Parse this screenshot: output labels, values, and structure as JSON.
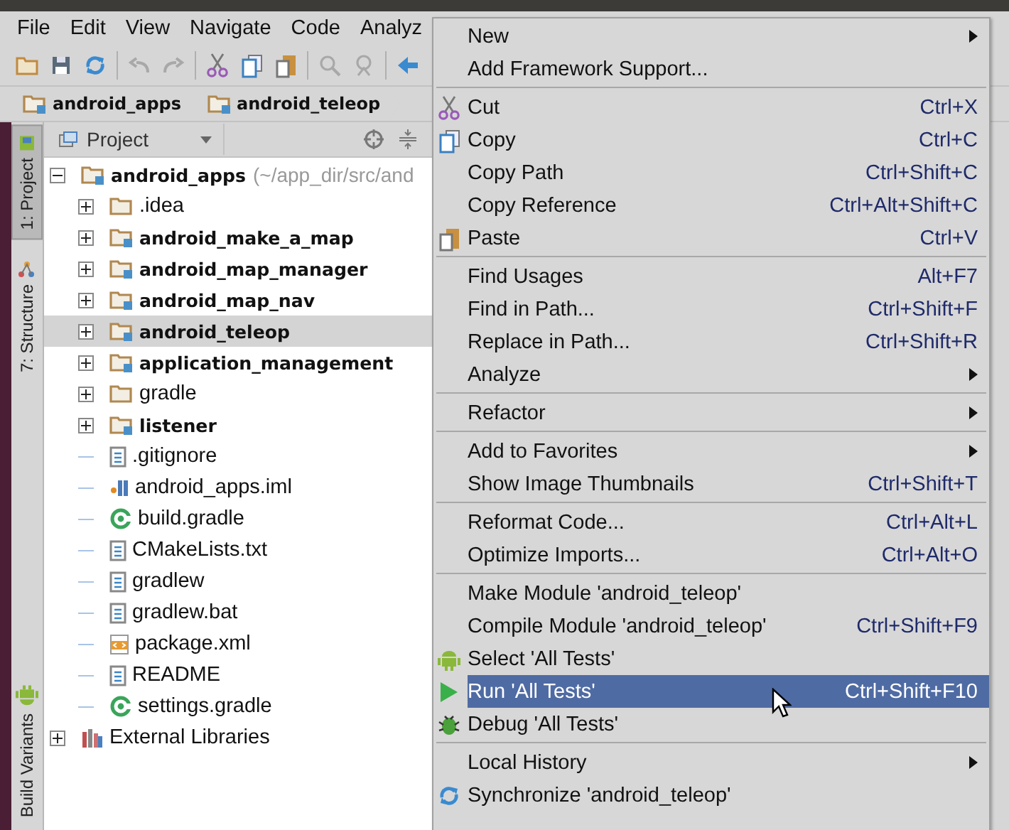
{
  "menubar": [
    {
      "label": "File"
    },
    {
      "label": "Edit"
    },
    {
      "label": "View"
    },
    {
      "label": "Navigate"
    },
    {
      "label": "Code"
    },
    {
      "label": "Analyz"
    }
  ],
  "toolbar": [
    {
      "kind": "open",
      "disabled": false
    },
    {
      "kind": "save",
      "disabled": false
    },
    {
      "kind": "sync",
      "disabled": false
    },
    {
      "kind": "sep"
    },
    {
      "kind": "undo",
      "disabled": true
    },
    {
      "kind": "redo",
      "disabled": true
    },
    {
      "kind": "sep"
    },
    {
      "kind": "cut",
      "disabled": false
    },
    {
      "kind": "copy",
      "disabled": false
    },
    {
      "kind": "paste",
      "disabled": false
    },
    {
      "kind": "sep"
    },
    {
      "kind": "find",
      "disabled": true
    },
    {
      "kind": "replace",
      "disabled": true
    },
    {
      "kind": "sep"
    },
    {
      "kind": "back",
      "disabled": false
    }
  ],
  "breadcrumbs": [
    {
      "label": "android_apps"
    },
    {
      "label": "android_teleop"
    }
  ],
  "side_tabs": {
    "top": [
      {
        "label": "1: Project",
        "selected": true,
        "kind": "project"
      },
      {
        "label": "7: Structure",
        "selected": false,
        "kind": "structure"
      }
    ],
    "bottom": [
      {
        "label": "Build Variants",
        "selected": false,
        "kind": "android"
      }
    ]
  },
  "project_panel": {
    "view": "Project"
  },
  "tree": [
    {
      "label": "android_apps",
      "path": "(~/app_dir/src/and",
      "kind": "module",
      "bold": true,
      "selected": false,
      "expanded": true,
      "children": [
        {
          "label": ".idea",
          "kind": "folder",
          "bold": false,
          "selected": false,
          "expanded": false
        },
        {
          "label": "android_make_a_map",
          "kind": "module",
          "bold": true,
          "selected": false,
          "expanded": false
        },
        {
          "label": "android_map_manager",
          "kind": "module",
          "bold": true,
          "selected": false,
          "expanded": false
        },
        {
          "label": "android_map_nav",
          "kind": "module",
          "bold": true,
          "selected": false,
          "expanded": false
        },
        {
          "label": "android_teleop",
          "kind": "module",
          "bold": true,
          "selected": true,
          "expanded": false
        },
        {
          "label": "application_management",
          "kind": "module",
          "bold": true,
          "selected": false,
          "expanded": false
        },
        {
          "label": "gradle",
          "kind": "folder",
          "bold": false,
          "selected": false,
          "expanded": false
        },
        {
          "label": "listener",
          "kind": "module",
          "bold": true,
          "selected": false,
          "expanded": false
        },
        {
          "label": ".gitignore",
          "kind": "text",
          "bold": false,
          "selected": false
        },
        {
          "label": "android_apps.iml",
          "kind": "iml",
          "bold": false,
          "selected": false
        },
        {
          "label": "build.gradle",
          "kind": "gradle",
          "bold": false,
          "selected": false
        },
        {
          "label": "CMakeLists.txt",
          "kind": "text",
          "bold": false,
          "selected": false
        },
        {
          "label": "gradlew",
          "kind": "text",
          "bold": false,
          "selected": false
        },
        {
          "label": "gradlew.bat",
          "kind": "text",
          "bold": false,
          "selected": false
        },
        {
          "label": "package.xml",
          "kind": "xml",
          "bold": false,
          "selected": false
        },
        {
          "label": "README",
          "kind": "text",
          "bold": false,
          "selected": false
        },
        {
          "label": "settings.gradle",
          "kind": "gradle",
          "bold": false,
          "selected": false
        }
      ]
    },
    {
      "label": "External Libraries",
      "kind": "libraries",
      "bold": false,
      "selected": false,
      "expanded": false
    }
  ],
  "context_menu": [
    [
      {
        "label": "New",
        "submenu": true,
        "selected": false
      },
      {
        "label": "Add Framework Support...",
        "selected": false
      }
    ],
    [
      {
        "label": "Cut",
        "shortcut": "Ctrl+X",
        "kind": "cut",
        "selected": false
      },
      {
        "label": "Copy",
        "shortcut": "Ctrl+C",
        "kind": "copy",
        "selected": false
      },
      {
        "label": "Copy Path",
        "shortcut": "Ctrl+Shift+C",
        "selected": false
      },
      {
        "label": "Copy Reference",
        "shortcut": "Ctrl+Alt+Shift+C",
        "selected": false
      },
      {
        "label": "Paste",
        "shortcut": "Ctrl+V",
        "kind": "paste",
        "selected": false
      }
    ],
    [
      {
        "label": "Find Usages",
        "shortcut": "Alt+F7",
        "selected": false
      },
      {
        "label": "Find in Path...",
        "shortcut": "Ctrl+Shift+F",
        "selected": false
      },
      {
        "label": "Replace in Path...",
        "shortcut": "Ctrl+Shift+R",
        "selected": false
      },
      {
        "label": "Analyze",
        "submenu": true,
        "selected": false
      }
    ],
    [
      {
        "label": "Refactor",
        "submenu": true,
        "selected": false
      }
    ],
    [
      {
        "label": "Add to Favorites",
        "submenu": true,
        "selected": false
      },
      {
        "label": "Show Image Thumbnails",
        "shortcut": "Ctrl+Shift+T",
        "selected": false
      }
    ],
    [
      {
        "label": "Reformat Code...",
        "shortcut": "Ctrl+Alt+L",
        "selected": false
      },
      {
        "label": "Optimize Imports...",
        "shortcut": "Ctrl+Alt+O",
        "selected": false
      }
    ],
    [
      {
        "label": "Make Module 'android_teleop'",
        "selected": false
      },
      {
        "label": "Compile Module 'android_teleop'",
        "shortcut": "Ctrl+Shift+F9",
        "selected": false
      },
      {
        "label": "Select 'All Tests'",
        "kind": "android",
        "selected": false
      },
      {
        "label": "Run 'All Tests'",
        "shortcut": "Ctrl+Shift+F10",
        "kind": "run",
        "selected": true
      },
      {
        "label": "Debug 'All Tests'",
        "kind": "debug",
        "selected": false
      }
    ],
    [
      {
        "label": "Local History",
        "submenu": true,
        "selected": false
      },
      {
        "label": "Synchronize 'android_teleop'",
        "kind": "sync",
        "selected": false
      }
    ]
  ]
}
